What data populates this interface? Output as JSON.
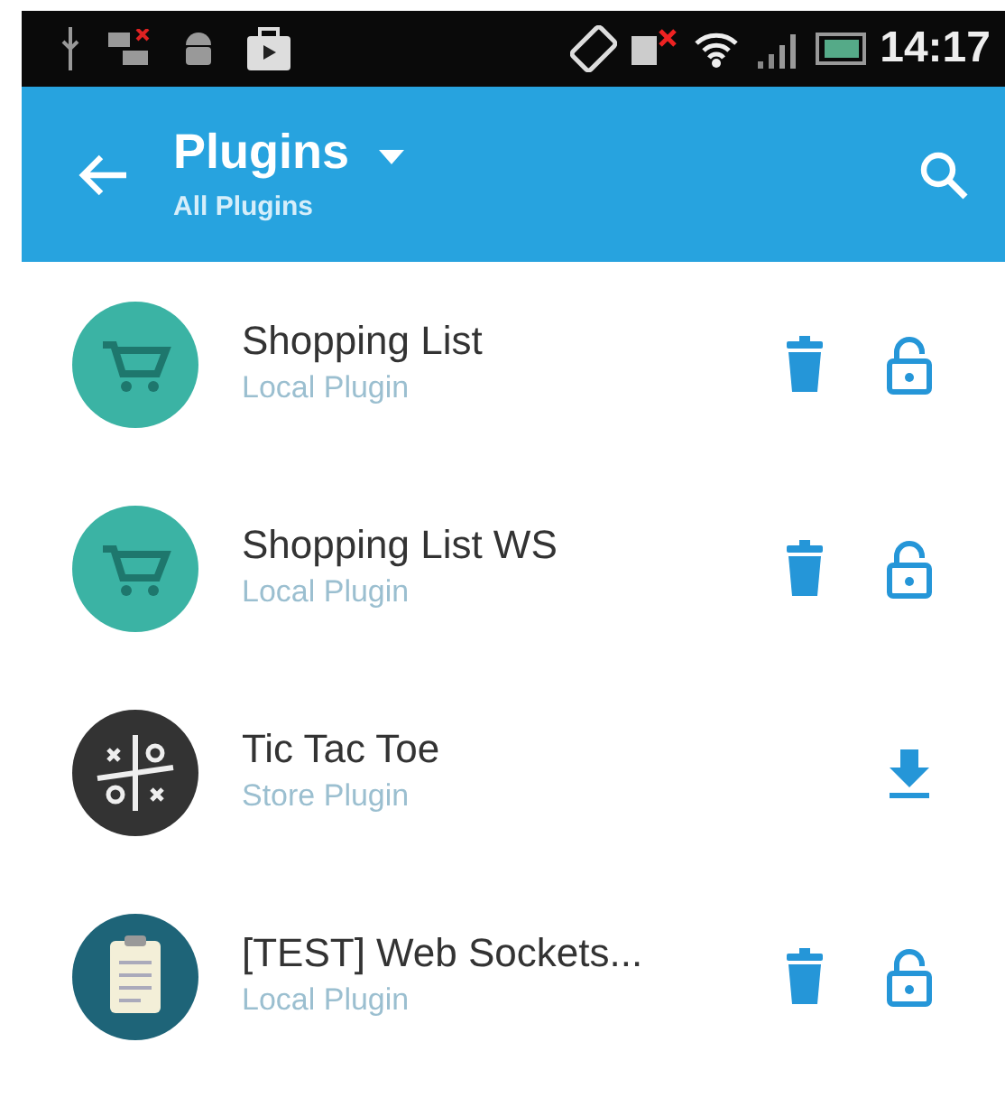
{
  "status_bar": {
    "time": "14:17"
  },
  "app_bar": {
    "title": "Plugins",
    "subtitle": "All Plugins"
  },
  "plugins": [
    {
      "name": "Shopping List",
      "source": "Local Plugin",
      "kind": "cart",
      "installed": true
    },
    {
      "name": "Shopping List WS",
      "source": "Local Plugin",
      "kind": "cart",
      "installed": true
    },
    {
      "name": "Tic Tac Toe",
      "source": "Store Plugin",
      "kind": "game",
      "installed": false
    },
    {
      "name": "[TEST] Web Sockets...",
      "source": "Local Plugin",
      "kind": "clipboard",
      "installed": true
    }
  ]
}
